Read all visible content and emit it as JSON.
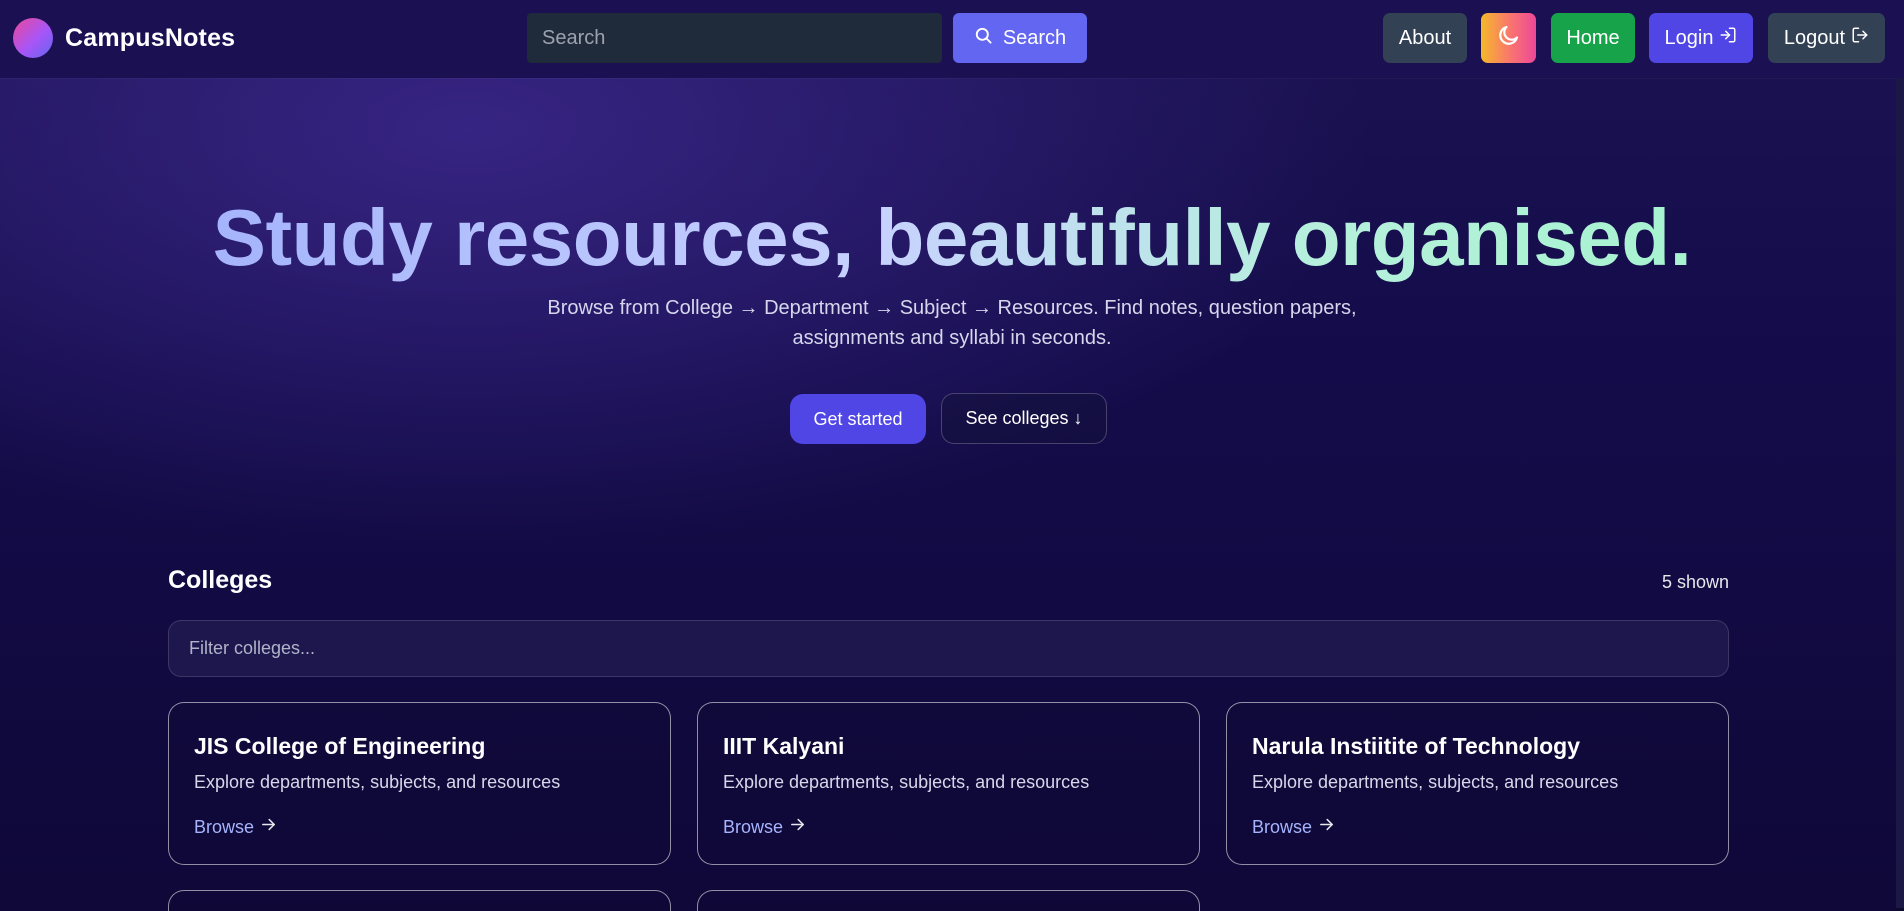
{
  "brand": {
    "name": "CampusNotes"
  },
  "search": {
    "placeholder": "Search",
    "button_label": "Search"
  },
  "nav": {
    "about_label": "About",
    "theme_toggle_icon": "moon-icon",
    "home_label": "Home",
    "login_label": "Login",
    "logout_label": "Logout"
  },
  "hero": {
    "title": "Study resources, beautifully organised.",
    "subtitle": "Browse from College → Department → Subject → Resources. Find notes, question papers, assignments and syllabi in seconds.",
    "primary_cta": "Get started",
    "secondary_cta": "See colleges ↓"
  },
  "colleges": {
    "title": "Colleges",
    "count_text": "5 shown",
    "filter_placeholder": "Filter colleges...",
    "items": [
      {
        "name": "JIS College of Engineering",
        "description": "Explore departments, subjects, and resources",
        "link_label": "Browse"
      },
      {
        "name": "IIIT Kalyani",
        "description": "Explore departments, subjects, and resources",
        "link_label": "Browse"
      },
      {
        "name": "Narula Instiitite of Technology",
        "description": "Explore departments, subjects, and resources",
        "link_label": "Browse"
      }
    ]
  },
  "colors": {
    "navbar_bg": "#1a1052",
    "primary": "#6366f1",
    "home_green": "#16a34a",
    "login_indigo": "#5046e5",
    "slate": "#334155",
    "link": "#a5b4fc"
  }
}
